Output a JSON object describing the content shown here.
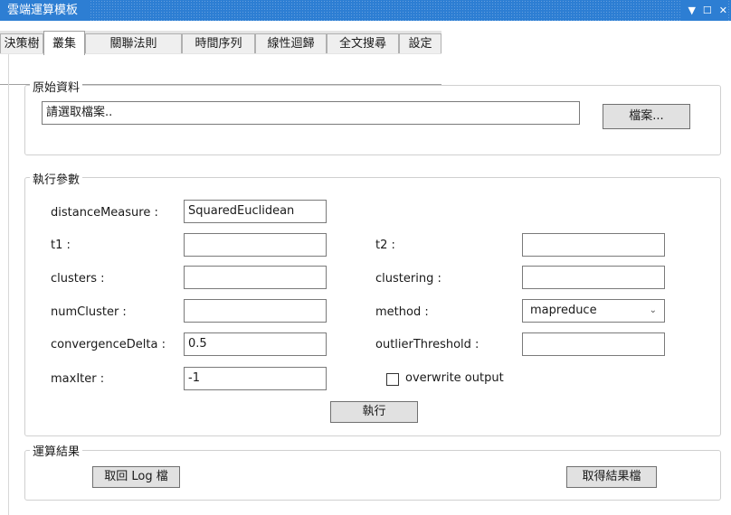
{
  "window": {
    "title": "雲端運算模板"
  },
  "titlebar_icons": {
    "dropdown": "▼",
    "maximize": "☐",
    "close": "✕"
  },
  "tabs": [
    "決策樹",
    "叢集",
    "關聯法則",
    "時間序列",
    "線性迴歸",
    "全文搜尋",
    "設定"
  ],
  "active_tab": "叢集",
  "raw_data": {
    "title": "原始資料",
    "file_path": "請選取檔案..",
    "browse_label": "檔案..."
  },
  "params": {
    "title": "執行參數",
    "distanceMeasure": {
      "label": "distanceMeasure :",
      "value": "SquaredEuclidean"
    },
    "t1": {
      "label": "t1 :",
      "value": ""
    },
    "t2": {
      "label": "t2 :",
      "value": ""
    },
    "clusters": {
      "label": "clusters :",
      "value": ""
    },
    "clustering": {
      "label": "clustering :",
      "value": ""
    },
    "numCluster": {
      "label": "numCluster :",
      "value": ""
    },
    "method": {
      "label": "method :",
      "value": "mapreduce"
    },
    "convergenceDelta": {
      "label": "convergenceDelta :",
      "value": "0.5"
    },
    "outlierThreshold": {
      "label": "outlierThreshold :",
      "value": ""
    },
    "maxIter": {
      "label": "maxIter :",
      "value": "-1"
    },
    "overwrite": {
      "label": "overwrite output",
      "checked": false
    },
    "run_label": "執行"
  },
  "results": {
    "title": "運算結果",
    "get_log_label": "取回 Log 檔",
    "get_result_label": "取得結果檔"
  }
}
